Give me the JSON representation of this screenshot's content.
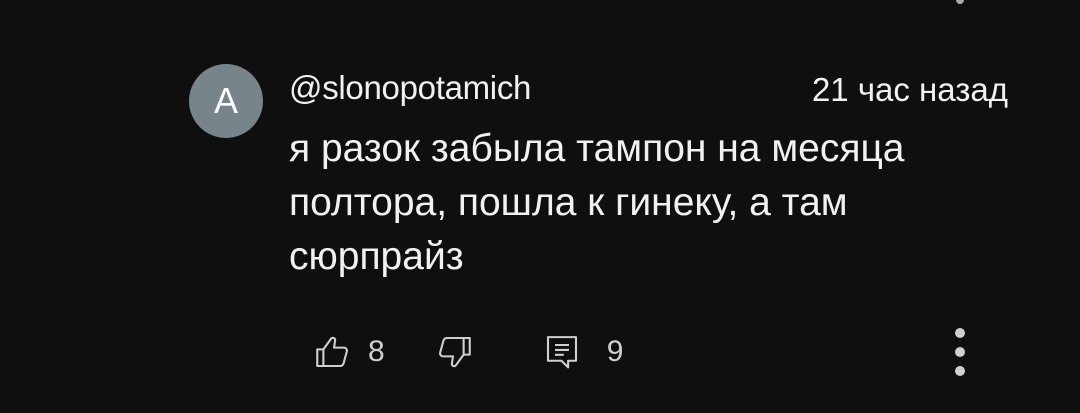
{
  "comment": {
    "avatar_letter": "A",
    "avatar_color": "#77858b",
    "author": "@slonopotamich",
    "timestamp": "21 час назад",
    "text": "я разок забыла тампон на месяца полтора, пошла к гинеку, а там сюрпрайз",
    "like_count": "8",
    "reply_count": "9"
  },
  "icons": {
    "like": "thumbs-up-icon",
    "dislike": "thumbs-down-icon",
    "reply": "comment-icon",
    "more": "more-vertical-icon"
  }
}
